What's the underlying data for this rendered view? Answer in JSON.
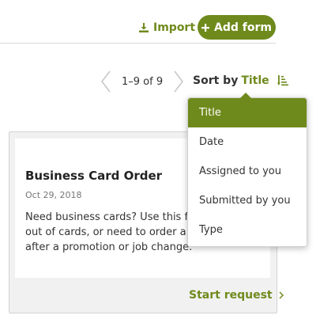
{
  "toolbar": {
    "import_label": "Import",
    "add_form_label": "Add form"
  },
  "pager": {
    "range_text": "1–9 of 9"
  },
  "sort": {
    "label": "Sort by",
    "value": "Title",
    "options": [
      "Title",
      "Date",
      "Assigned to you",
      "Submitted by you",
      "Type"
    ]
  },
  "card": {
    "title": "Business Card Order",
    "date": "Oct 29, 2018",
    "description_lines": [
      "Need business cards? Use this fo",
      "out of cards, or need to order a n",
      "after a promotion or job change."
    ],
    "action_label": "Start request"
  },
  "colors": {
    "accent": "#6f8a1c"
  }
}
